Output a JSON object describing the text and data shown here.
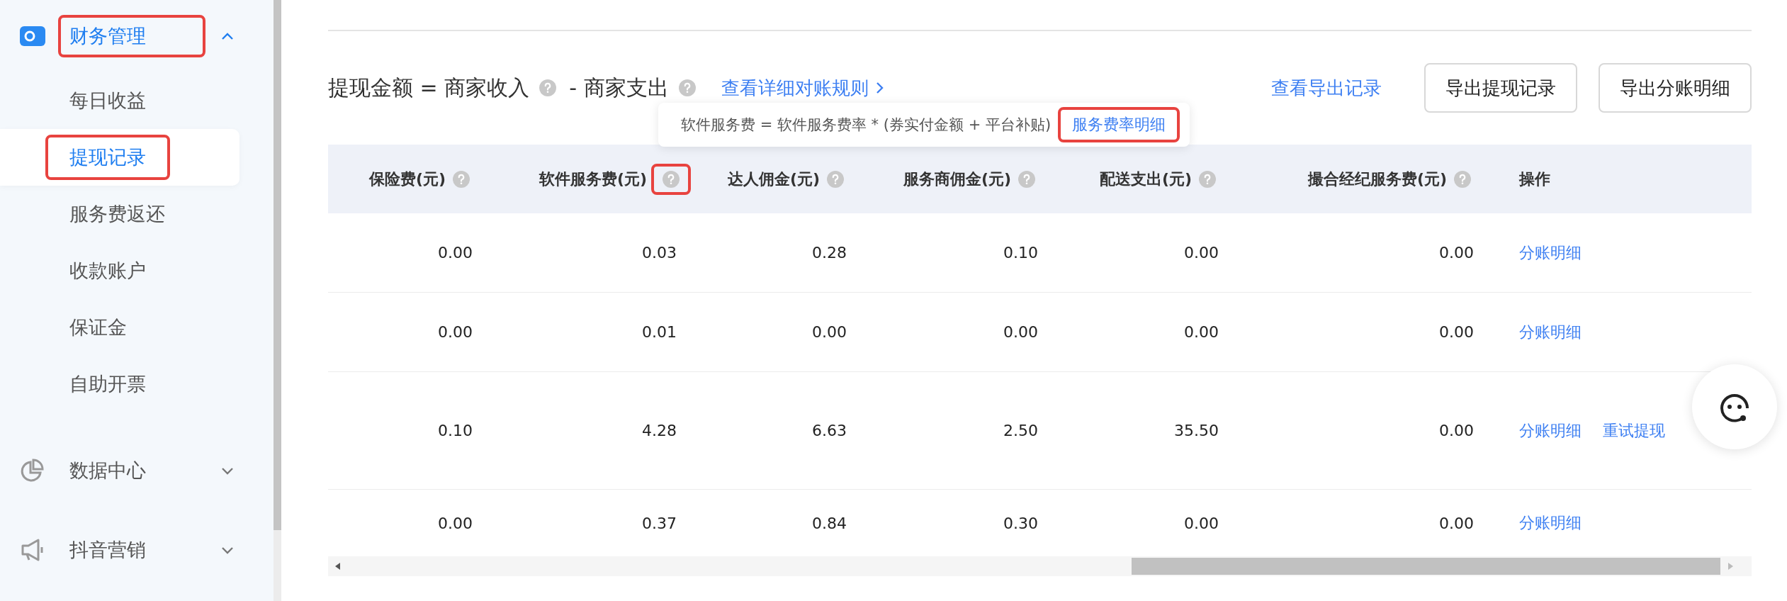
{
  "sidebar": {
    "groups": [
      {
        "label": "财务管理",
        "expanded": true,
        "highlighted": true,
        "children": [
          {
            "label": "每日收益",
            "selected": false,
            "highlighted": false
          },
          {
            "label": "提现记录",
            "selected": true,
            "highlighted": true
          },
          {
            "label": "服务费返还",
            "selected": false,
            "highlighted": false
          },
          {
            "label": "收款账户",
            "selected": false,
            "highlighted": false
          },
          {
            "label": "保证金",
            "selected": false,
            "highlighted": false
          },
          {
            "label": "自助开票",
            "selected": false,
            "highlighted": false
          }
        ]
      },
      {
        "label": "数据中心",
        "expanded": false,
        "highlighted": false
      },
      {
        "label": "抖音营销",
        "expanded": false,
        "highlighted": false
      }
    ]
  },
  "header": {
    "formula_title": "提现金额 = 商家收入",
    "formula_minus": "- 商家支出",
    "rules_link": "查看详细对账规则",
    "export_log_link": "查看导出记录",
    "buttons": [
      "导出提现记录",
      "导出分账明细"
    ]
  },
  "tooltip": {
    "text": "软件服务费 = 软件服务费率 * (券实付金额 + 平台补贴)",
    "link": "服务费率明细",
    "highlighted": true
  },
  "table": {
    "columns": [
      {
        "label": "保险费(元)",
        "help": true,
        "highlighted": false
      },
      {
        "label": "软件服务费(元)",
        "help": true,
        "highlighted": true
      },
      {
        "label": "达人佣金(元)",
        "help": true,
        "highlighted": false
      },
      {
        "label": "服务商佣金(元)",
        "help": true,
        "highlighted": false
      },
      {
        "label": "配送支出(元)",
        "help": true,
        "highlighted": false
      },
      {
        "label": "撮合经纪服务费(元)",
        "help": true,
        "highlighted": false
      },
      {
        "label": "操作"
      }
    ],
    "rows": [
      {
        "cells": [
          "0.00",
          "0.03",
          "0.28",
          "0.10",
          "0.00",
          "0.00"
        ],
        "actions": [
          "分账明细"
        ]
      },
      {
        "cells": [
          "0.00",
          "0.01",
          "0.00",
          "0.00",
          "0.00",
          "0.00"
        ],
        "actions": [
          "分账明细"
        ]
      },
      {
        "cells": [
          "0.10",
          "4.28",
          "6.63",
          "2.50",
          "35.50",
          "0.00"
        ],
        "actions": [
          "分账明细",
          "重试提现"
        ]
      },
      {
        "cells": [
          "0.00",
          "0.37",
          "0.84",
          "0.30",
          "0.00",
          "0.00"
        ],
        "actions": [
          "分账明细"
        ]
      }
    ]
  }
}
